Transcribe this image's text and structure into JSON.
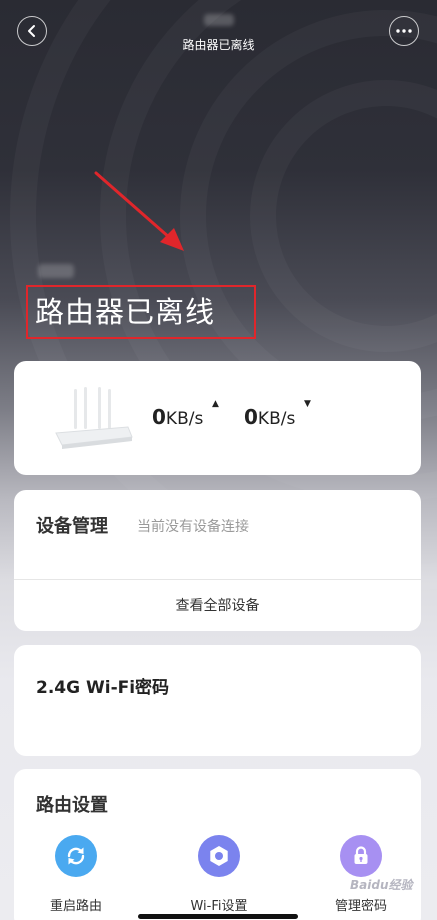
{
  "header": {
    "subtitle": "路由器已离线"
  },
  "status": {
    "title": "路由器已离线"
  },
  "speed": {
    "upload_value": "0",
    "upload_unit": "KB/s",
    "download_value": "0",
    "download_unit": "KB/s"
  },
  "devices": {
    "title": "设备管理",
    "subtitle": "当前没有设备连接",
    "view_all": "查看全部设备"
  },
  "wifi": {
    "title": "2.4G Wi-Fi密码"
  },
  "settings": {
    "title": "路由设置",
    "items": [
      {
        "label": "重启路由",
        "icon": "refresh-icon",
        "color": "#4aa9f0"
      },
      {
        "label": "Wi-Fi设置",
        "icon": "gear-icon",
        "color": "#7b83ee"
      },
      {
        "label": "管理密码",
        "icon": "lock-icon",
        "color": "#a790f2"
      }
    ]
  },
  "watermark": "Baidu经验",
  "colors": {
    "highlight_box": "#e0262b",
    "arrow": "#e0262b"
  }
}
